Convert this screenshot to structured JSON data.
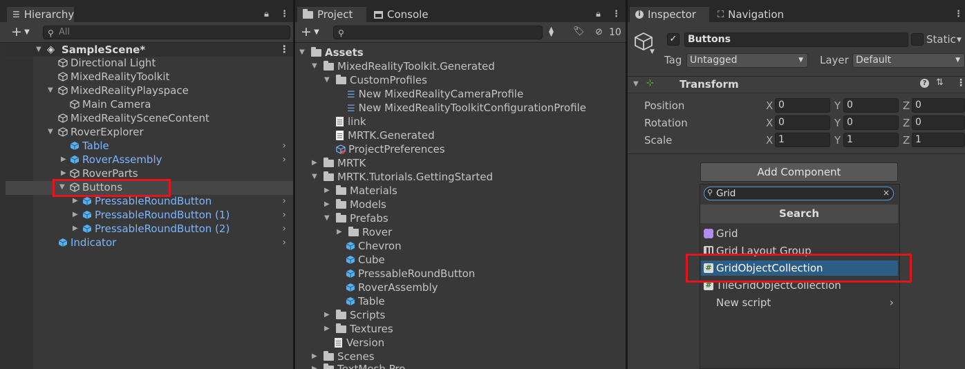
{
  "hierarchy": {
    "tab_label": "Hierarchy",
    "search_placeholder": "All",
    "items": [
      {
        "label": "SampleScene*"
      },
      {
        "label": "Directional Light"
      },
      {
        "label": "MixedRealityToolkit"
      },
      {
        "label": "MixedRealityPlayspace"
      },
      {
        "label": "Main Camera"
      },
      {
        "label": "MixedRealitySceneContent"
      },
      {
        "label": "RoverExplorer"
      },
      {
        "label": "Table"
      },
      {
        "label": "RoverAssembly"
      },
      {
        "label": "RoverParts"
      },
      {
        "label": "Buttons"
      },
      {
        "label": "PressableRoundButton"
      },
      {
        "label": "PressableRoundButton (1)"
      },
      {
        "label": "PressableRoundButton (2)"
      },
      {
        "label": "Indicator"
      }
    ]
  },
  "project": {
    "tab_project": "Project",
    "tab_console": "Console",
    "hidden_count": "10",
    "items": [
      {
        "label": "Assets"
      },
      {
        "label": "MixedRealityToolkit.Generated"
      },
      {
        "label": "CustomProfiles"
      },
      {
        "label": "New MixedRealityCameraProfile"
      },
      {
        "label": "New MixedRealityToolkitConfigurationProfile"
      },
      {
        "label": "link"
      },
      {
        "label": "MRTK.Generated"
      },
      {
        "label": "ProjectPreferences"
      },
      {
        "label": "MRTK"
      },
      {
        "label": "MRTK.Tutorials.GettingStarted"
      },
      {
        "label": "Materials"
      },
      {
        "label": "Models"
      },
      {
        "label": "Prefabs"
      },
      {
        "label": "Rover"
      },
      {
        "label": "Chevron"
      },
      {
        "label": "Cube"
      },
      {
        "label": "PressableRoundButton"
      },
      {
        "label": "RoverAssembly"
      },
      {
        "label": "Table"
      },
      {
        "label": "Scripts"
      },
      {
        "label": "Textures"
      },
      {
        "label": "Version"
      },
      {
        "label": "Scenes"
      },
      {
        "label": "TextMesh Pro"
      }
    ]
  },
  "inspector": {
    "tab_inspector": "Inspector",
    "tab_navigation": "Navigation",
    "object_name": "Buttons",
    "static_label": "Static",
    "tag_label": "Tag",
    "tag_value": "Untagged",
    "layer_label": "Layer",
    "layer_value": "Default",
    "transform_title": "Transform",
    "position_label": "Position",
    "rotation_label": "Rotation",
    "scale_label": "Scale",
    "x": "X",
    "y": "Y",
    "z": "Z",
    "position": [
      "0",
      "0",
      "0"
    ],
    "rotation": [
      "0",
      "0",
      "0"
    ],
    "scale": [
      "1",
      "1",
      "1"
    ],
    "add_component": "Add Component",
    "component_search": "Grid",
    "search_header": "Search",
    "results": [
      {
        "label": "Grid"
      },
      {
        "label": "Grid Layout Group"
      },
      {
        "label": "GridObjectCollection"
      },
      {
        "label": "TileGridObjectCollection"
      },
      {
        "label": "New script"
      }
    ]
  },
  "colors": {
    "highlight_red": "#e3141b",
    "selection_blue": "#2c5d87",
    "prefab_blue": "#7cb6ff"
  }
}
